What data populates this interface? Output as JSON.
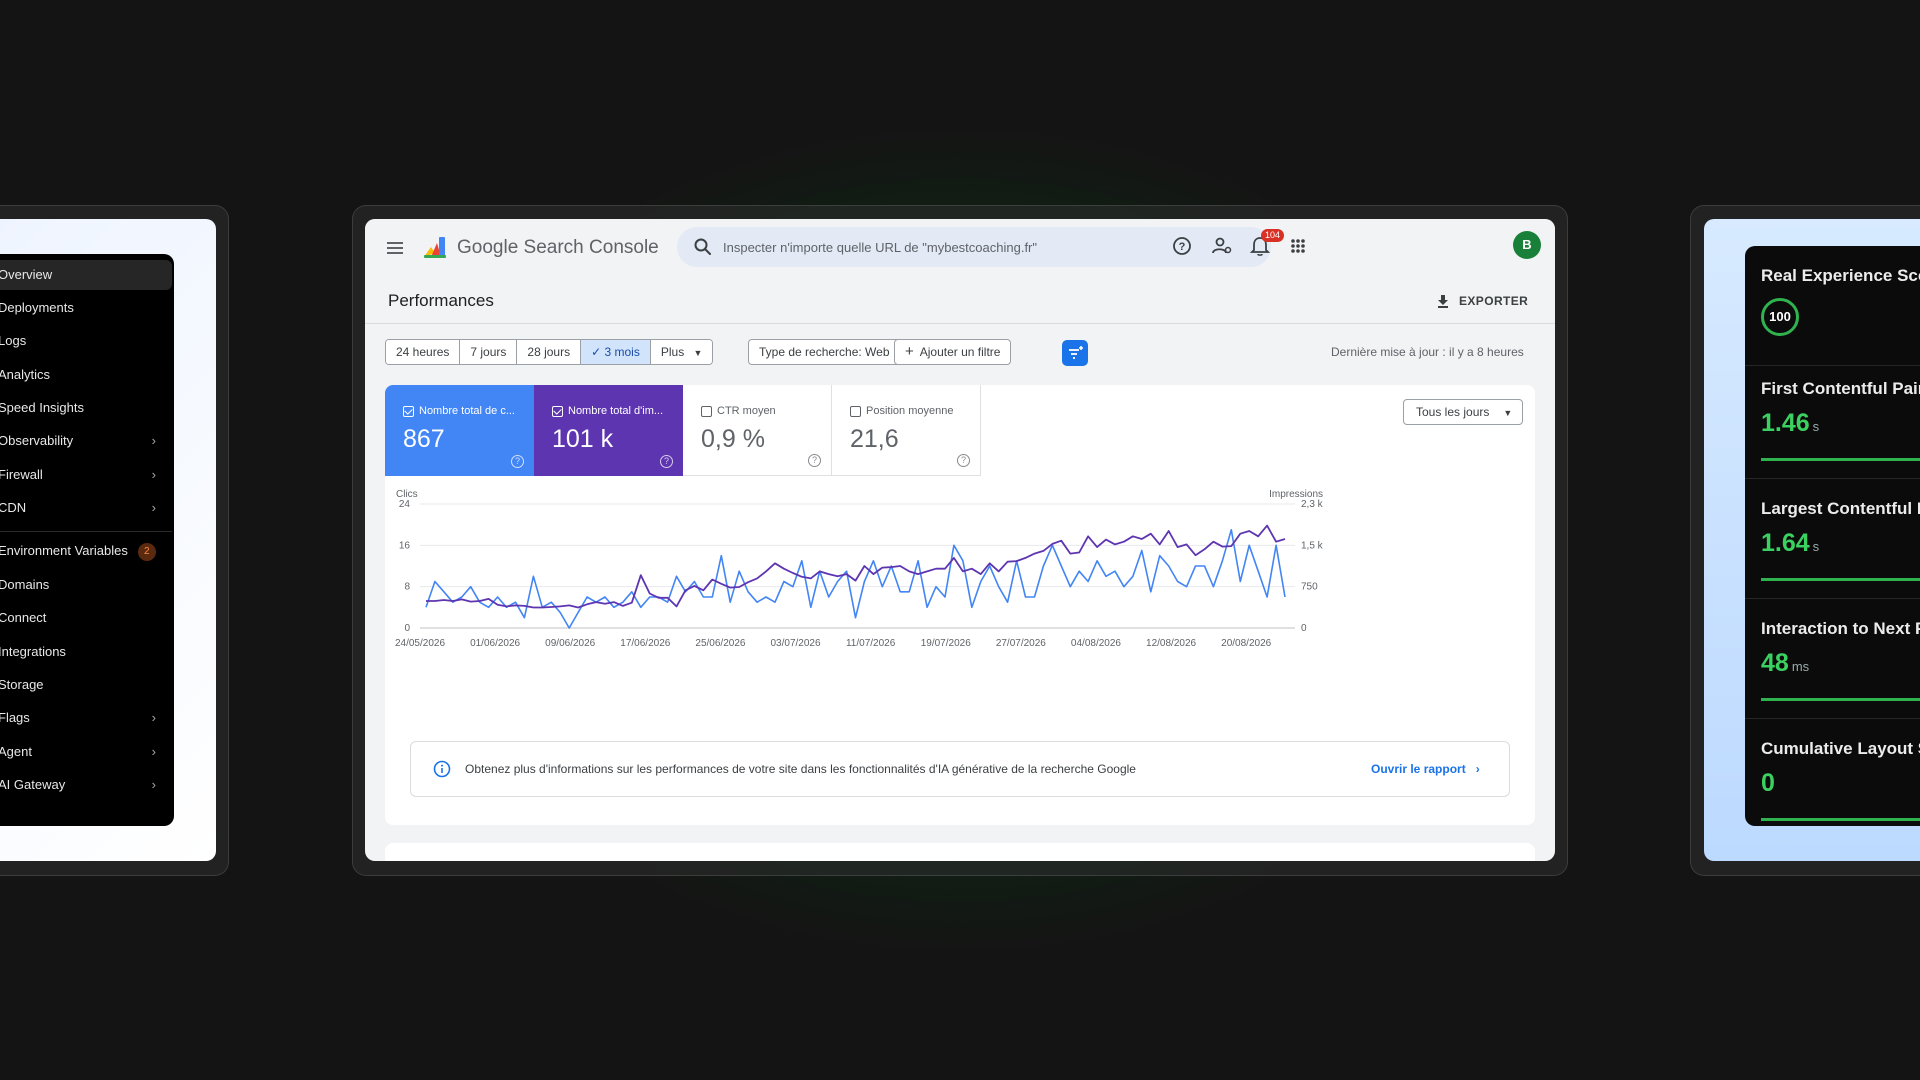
{
  "left_sidebar": {
    "items": [
      {
        "label": "Overview",
        "active": true
      },
      {
        "label": "Deployments"
      },
      {
        "label": "Logs"
      },
      {
        "label": "Analytics"
      },
      {
        "label": "Speed Insights"
      },
      {
        "label": "Observability",
        "chevron": true
      },
      {
        "label": "Firewall",
        "chevron": true
      },
      {
        "label": "CDN",
        "chevron": true
      },
      {
        "label": "Environment Variables",
        "badge": "2"
      },
      {
        "label": "Domains"
      },
      {
        "label": "Connect"
      },
      {
        "label": "Integrations"
      },
      {
        "label": "Storage"
      },
      {
        "label": "Flags",
        "chevron": true
      },
      {
        "label": "Agent",
        "chevron": true
      },
      {
        "label": "AI Gateway",
        "chevron": true
      }
    ]
  },
  "gsc": {
    "app_title": "Google Search Console",
    "search_placeholder": "Inspecter n'importe quelle URL de \"mybestcoaching.fr\"",
    "notifications_count": "104",
    "avatar_initial": "B",
    "page_title": "Performances",
    "export_label": "EXPORTER",
    "date_ranges": [
      "24 heures",
      "7 jours",
      "28 jours",
      "3 mois",
      "Plus"
    ],
    "selected_range": "3 mois",
    "search_type": "Type de recherche: Web",
    "add_filter": "Ajouter un filtre",
    "last_update": "Dernière mise à jour : il y a 8 heures",
    "metrics": {
      "clicks": {
        "label": "Nombre total de c...",
        "value": "867"
      },
      "impressions": {
        "label": "Nombre total d'im...",
        "value": "101 k"
      },
      "ctr": {
        "label": "CTR moyen",
        "value": "0,9 %"
      },
      "position": {
        "label": "Position moyenne",
        "value": "21,6"
      }
    },
    "days_select": "Tous les jours",
    "info_banner": {
      "text": "Obtenez plus d'informations sur les performances de votre site dans les fonctionnalités d'IA générative de la recherche Google",
      "link": "Ouvrir le rapport"
    },
    "colors": {
      "clicks": "#4285f4",
      "impressions": "#5e35b1",
      "accent": "#1a73e8"
    }
  },
  "chart_data": {
    "type": "line",
    "ylabel": "Clics",
    "y2label": "Impressions",
    "ylim": [
      0,
      24
    ],
    "y2lim": [
      0,
      2300
    ],
    "yticks": [
      "0",
      "8",
      "16",
      "24"
    ],
    "y2ticks": [
      "0",
      "750",
      "1,5 k",
      "2,3 k"
    ],
    "xticks": [
      "24/05/2026",
      "01/06/2026",
      "09/06/2026",
      "17/06/2026",
      "25/06/2026",
      "03/07/2026",
      "11/07/2026",
      "19/07/2026",
      "27/07/2026",
      "04/08/2026",
      "12/08/2026",
      "20/08/2026"
    ],
    "series": [
      {
        "name": "Clics",
        "axis": "left",
        "color": "#4285f4",
        "values": [
          4,
          9,
          7,
          5,
          6,
          8,
          5,
          4,
          6,
          4,
          5,
          2,
          10,
          4,
          5,
          3,
          0,
          3,
          6,
          5,
          6,
          4,
          5,
          7,
          4,
          6,
          6,
          5,
          10,
          7,
          9,
          6,
          6,
          14,
          5,
          11,
          7,
          5,
          6,
          5,
          9,
          8,
          13,
          4,
          11,
          6,
          9,
          11,
          2,
          9,
          13,
          8,
          12,
          7,
          7,
          13,
          4,
          8,
          6,
          16,
          13,
          4,
          9,
          12,
          8,
          5,
          13,
          6,
          6,
          12,
          16,
          12,
          8,
          11,
          9,
          13,
          10,
          11,
          8,
          10,
          15,
          7,
          14,
          12,
          9,
          8,
          12,
          12,
          8,
          13,
          19,
          9,
          16,
          11,
          6,
          16,
          6
        ]
      },
      {
        "name": "Impressions",
        "axis": "right",
        "color": "#5e35b1",
        "values": [
          500,
          500,
          520,
          500,
          530,
          490,
          500,
          540,
          430,
          400,
          420,
          410,
          380,
          380,
          390,
          400,
          420,
          380,
          440,
          480,
          450,
          480,
          410,
          470,
          980,
          640,
          560,
          560,
          400,
          700,
          780,
          700,
          900,
          820,
          750,
          760,
          850,
          920,
          1050,
          1200,
          1100,
          1020,
          950,
          920,
          1050,
          1000,
          960,
          1000,
          880,
          1150,
          1000,
          1120,
          1130,
          1150,
          1050,
          1000,
          1050,
          1100,
          1100,
          1300,
          1050,
          1100,
          1000,
          1200,
          1050,
          1230,
          1240,
          1300,
          1380,
          1430,
          1560,
          1620,
          1380,
          1400,
          1700,
          1500,
          1640,
          1550,
          1600,
          1700,
          1650,
          1750,
          1550,
          1800,
          1500,
          1550,
          1350,
          1460,
          1600,
          1510,
          1520,
          1750,
          1800,
          1700,
          1900,
          1600,
          1650
        ]
      }
    ]
  },
  "right_card": {
    "metrics": [
      {
        "title": "Real Experience Score",
        "score": "100"
      },
      {
        "title": "First Contentful Paint",
        "value": "1.46",
        "unit": "s"
      },
      {
        "title": "Largest Contentful Paint",
        "value": "1.64",
        "unit": "s"
      },
      {
        "title": "Interaction to Next Paint",
        "value": "48",
        "unit": "ms"
      },
      {
        "title": "Cumulative Layout Shift",
        "value": "0",
        "unit": ""
      }
    ]
  }
}
